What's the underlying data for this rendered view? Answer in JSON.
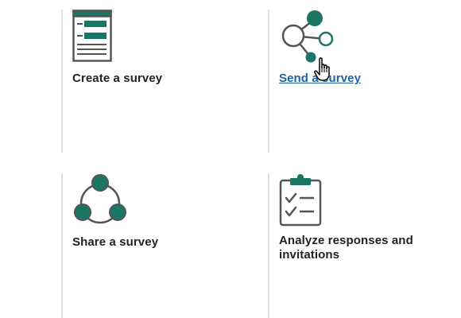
{
  "cards": [
    {
      "label": "Create a survey",
      "icon": "survey-form-icon"
    },
    {
      "label": "Send a survey",
      "icon": "share-nodes-icon"
    },
    {
      "label": "Share a survey",
      "icon": "share-circle-icon"
    },
    {
      "label": "Analyze responses and invitations",
      "icon": "clipboard-checklist-icon"
    }
  ],
  "colors": {
    "accent": "#1a7565",
    "outline": "#555555",
    "link": "#2062a6",
    "divider": "#e1e1e1"
  }
}
